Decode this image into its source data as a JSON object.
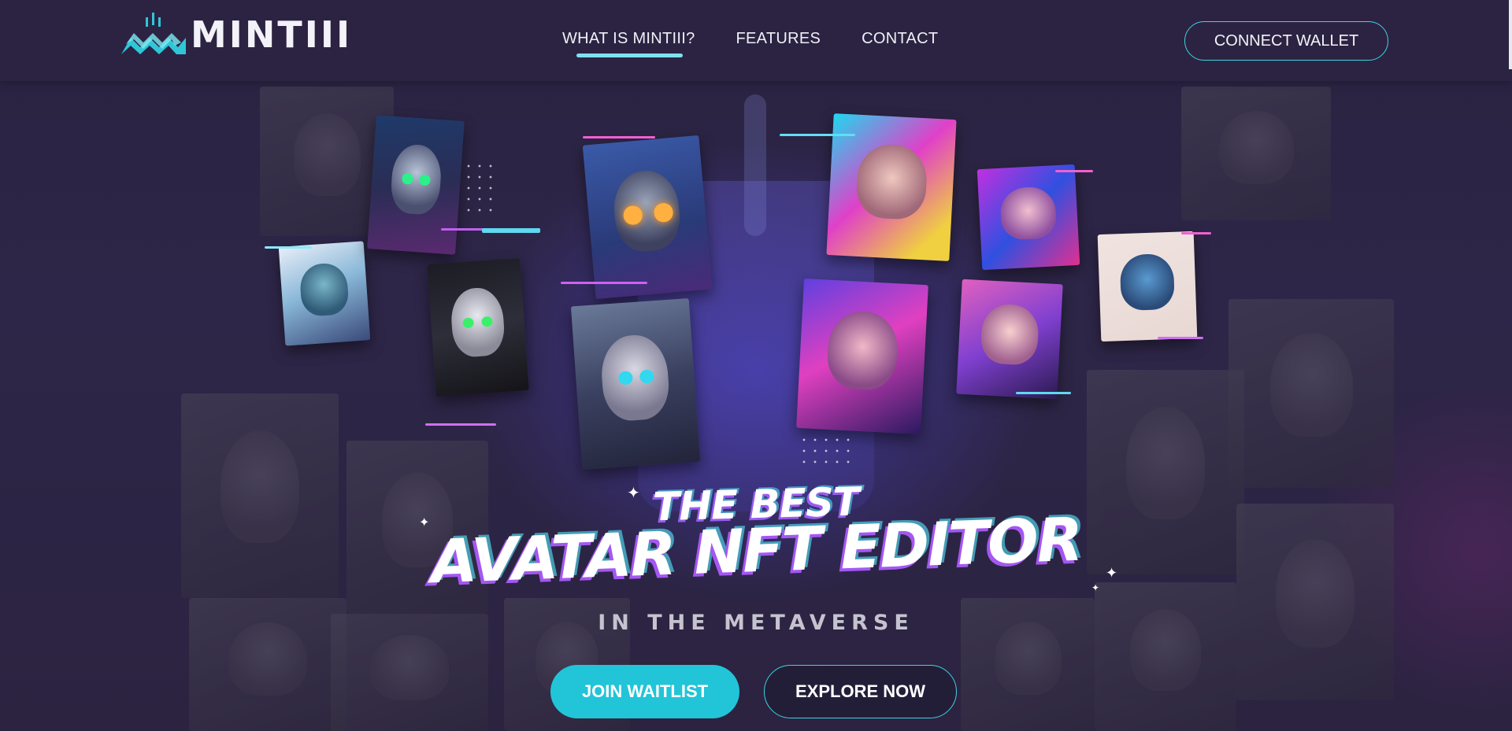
{
  "brand": {
    "logo_text": "MINTIII",
    "logo_icon": "mintiii-logo-icon",
    "accent": "#3fd2e2"
  },
  "nav": {
    "items": [
      {
        "label": "WHAT IS MINTIII?",
        "active": true
      },
      {
        "label": "FEATURES",
        "active": false
      },
      {
        "label": "CONTACT",
        "active": false
      }
    ]
  },
  "header": {
    "connect_label": "CONNECT WALLET"
  },
  "hero": {
    "title_top": "THE BEST",
    "title_main": "AVATAR NFT EDITOR",
    "subtitle": "IN THE METAVERSE",
    "primary_cta": "JOIN WAITLIST",
    "secondary_cta": "EXPLORE NOW",
    "primary_color": "#22c4d8"
  },
  "gallery": {
    "cards": [
      {
        "name": "nft-card-alien-blue"
      },
      {
        "name": "nft-card-cyber-cat-1"
      },
      {
        "name": "nft-card-cyber-cat-2"
      },
      {
        "name": "nft-card-robot-cat-orange-eye"
      },
      {
        "name": "nft-card-astronaut-cat"
      },
      {
        "name": "nft-card-neon-girl-1"
      },
      {
        "name": "nft-card-neon-girl-2"
      },
      {
        "name": "nft-card-neon-girl-3"
      },
      {
        "name": "nft-card-neon-girl-4"
      },
      {
        "name": "nft-card-blue-hair-warrior"
      }
    ]
  }
}
